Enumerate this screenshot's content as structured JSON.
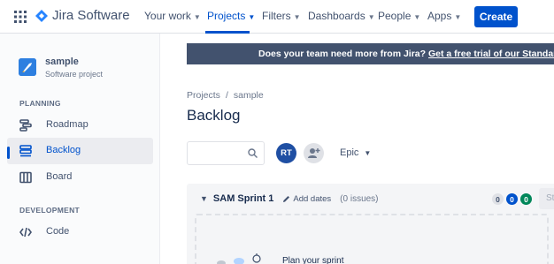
{
  "nav": {
    "product": "Jira Software",
    "items": [
      {
        "label": "Your work"
      },
      {
        "label": "Projects"
      },
      {
        "label": "Filters"
      },
      {
        "label": "Dashboards"
      },
      {
        "label": "People"
      },
      {
        "label": "Apps"
      }
    ],
    "active_item": "Projects",
    "create_label": "Create",
    "colors": {
      "brand": "#0052cc"
    }
  },
  "sidebar": {
    "project_name": "sample",
    "project_type": "Software project",
    "planning_label": "PLANNING",
    "development_label": "DEVELOPMENT",
    "items": [
      {
        "label": "Roadmap",
        "icon": "roadmap-icon"
      },
      {
        "label": "Backlog",
        "icon": "backlog-icon"
      },
      {
        "label": "Board",
        "icon": "board-icon"
      },
      {
        "label": "Code",
        "icon": "code-icon"
      }
    ],
    "selected": "Backlog"
  },
  "banner": {
    "text": "Does your team need more from Jira?",
    "link": "Get a free trial of our Standard p"
  },
  "main": {
    "breadcrumb": [
      "Projects",
      "/",
      "sample"
    ],
    "title": "Backlog",
    "search": {
      "placeholder": "",
      "icon": "search-icon"
    },
    "avatar_initials": "RT",
    "epic_label": "Epic"
  },
  "sprint": {
    "name": "SAM Sprint 1",
    "add_dates": "Add dates",
    "issue_count": "(0 issues)",
    "badges": {
      "todo": "0",
      "in_progress": "0",
      "done": "0"
    },
    "start_label": "St",
    "empty_text": "Plan your sprint"
  }
}
